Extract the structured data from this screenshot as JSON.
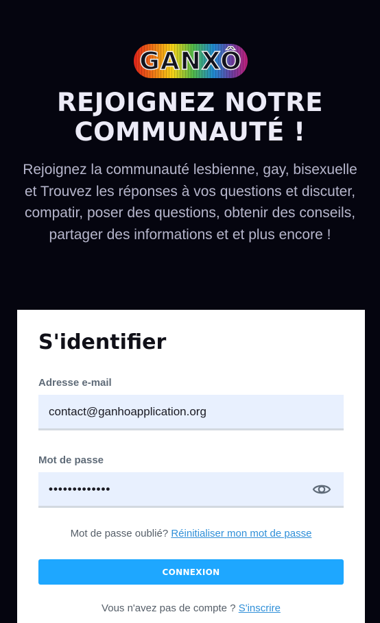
{
  "brand": {
    "logo_text": "GANXÔ"
  },
  "hero": {
    "headline_line1": "REJOIGNEZ NOTRE",
    "headline_line2": "COMMUNAUTÉ !",
    "intro": "Rejoignez la communauté lesbienne, gay, bisexuelle et Trouvez les réponses à vos questions et discuter, compatir, poser des questions, obtenir des conseils, partager des informations et et plus encore !"
  },
  "login": {
    "title": "S'identifier",
    "email_label": "Adresse e-mail",
    "email_value": "contact@ganhoapplication.org",
    "password_label": "Mot de passe",
    "password_value": "•••••••••••••",
    "forgot_prefix": "Mot de passe oublié?",
    "forgot_link": "Réinitialiser mon mot de passe",
    "submit_label": "CONNEXION",
    "signup_prefix": "Vous n'avez pas de compte ?",
    "signup_link": "S'inscrire"
  },
  "icons": {
    "password_toggle": "eye-icon"
  },
  "colors": {
    "background": "#05050f",
    "card": "#ffffff",
    "input_fill": "#e8f0fe",
    "button": "#1ea7ff",
    "link": "#2f8fd8"
  }
}
